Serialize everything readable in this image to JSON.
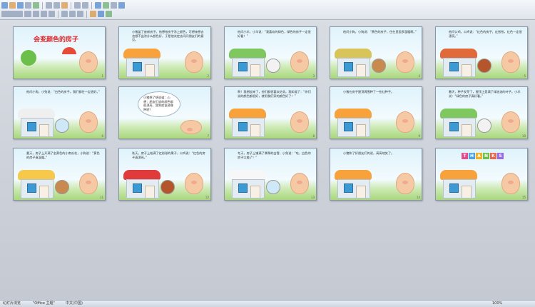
{
  "window": {
    "status_slide": "幻灯片浏览",
    "status_theme": "\"Office 主题\"",
    "status_lang": "中文(中国)",
    "status_zoom": "100%"
  },
  "slides": [
    {
      "num": "1",
      "title": "会变颜色的房子",
      "text": "",
      "roof": "",
      "animal": "",
      "animal_color": ""
    },
    {
      "num": "2",
      "title": "",
      "text": "小猪盖了座新房子。他想给房子涂上颜色，可想来想去也想不出涂什么颜色好，于是他决定去问问朋友们的意见。",
      "roof": "#f7a23a",
      "animal": "",
      "animal_color": ""
    },
    {
      "num": "3",
      "title": "",
      "text": "他问小羊，小羊说：“我喜欢的绿色，绿色的房子一定很好看！”",
      "roof": "#7fc75f",
      "animal": "sheep-icon",
      "animal_color": "#f2f2f2"
    },
    {
      "num": "4",
      "title": "",
      "text": "他问小狗，小狗说：“黄色的房子，住在里面多温暖啊。”",
      "roof": "#d9c45a",
      "animal": "dog-icon",
      "animal_color": "#c98a50"
    },
    {
      "num": "5",
      "title": "",
      "text": "他问公鸡，公鸡说：“红色的房子，红彤彤，红色一定很漂亮。”",
      "roof": "#e06a3a",
      "animal": "rooster-icon",
      "animal_color": "#b5552b"
    },
    {
      "num": "6",
      "title": "",
      "text": "他问小兔，小兔说：“白色的房子，我们都住一定很好。”",
      "roof": "#efefef",
      "animal": "rabbit-icon",
      "animal_color": "#cfe8f7"
    },
    {
      "num": "7",
      "title": "",
      "text": "小猪想了想说道：心想：朋友们说的颜色都很漂亮，我到底该选哪种呢？",
      "roof": "",
      "animal": "",
      "animal_color": ""
    },
    {
      "num": "8",
      "title": "",
      "text": "啊！我想起来了，他们都很喜欢花朵。我知道了：“你们说的颜色都很好，就用我们家的颜色好了！”",
      "roof": "#f7a23a",
      "animal": "",
      "animal_color": ""
    },
    {
      "num": "9",
      "title": "",
      "text": "小猪在房子屋顶周围种了一些红种子。",
      "roof": "#f7a23a",
      "animal": "",
      "animal_color": ""
    },
    {
      "num": "10",
      "title": "",
      "text": "春天，种子发芽了，屋顶上是满了绿油油的叶子。小羊说：“绿色的房子真好看。”",
      "roof": "#7fc75f",
      "animal": "sheep-icon",
      "animal_color": "#f2f2f2"
    },
    {
      "num": "11",
      "title": "",
      "text": "夏天，房子上开满了金黄色的小南瓜花，小狗说：“黄色的房子真温暖。”",
      "roof": "#f7c94a",
      "animal": "dog-icon",
      "animal_color": "#c98a50"
    },
    {
      "num": "12",
      "title": "",
      "text": "秋天，房子上结满了红彤彤的果子，公鸡说：“红色的房子真漂亮。”",
      "roof": "#e03a3a",
      "animal": "rooster-icon",
      "animal_color": "#b5552b"
    },
    {
      "num": "13",
      "title": "",
      "text": "冬天，房子上铺满了厚厚的白雪，小兔说：“哇，白色的房子太美了！”",
      "roof": "#f7f7f7",
      "animal": "rabbit-icon",
      "animal_color": "#cfe8f7"
    },
    {
      "num": "14",
      "title": "",
      "text": "小猪和了好朋友们的说，高高地笑了。",
      "roof": "#f7a23a",
      "animal": "",
      "animal_color": ""
    },
    {
      "num": "15",
      "title": "THANKS",
      "text": "",
      "roof": "#f7a23a",
      "animal": "",
      "animal_color": ""
    }
  ]
}
